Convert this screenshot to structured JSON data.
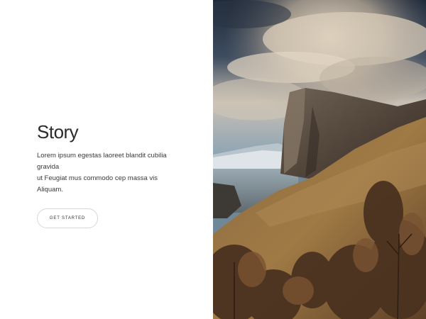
{
  "story": {
    "title": "Story",
    "body_line_1": "Lorem ipsum egestas laoreet blandit cubilia gravida",
    "body_line_2": "ut Feugiat mus commodo cep massa vis Aliquam.",
    "cta_label": "GET STARTED"
  },
  "hero_image": {
    "icon": "mountain-landscape-photo"
  }
}
